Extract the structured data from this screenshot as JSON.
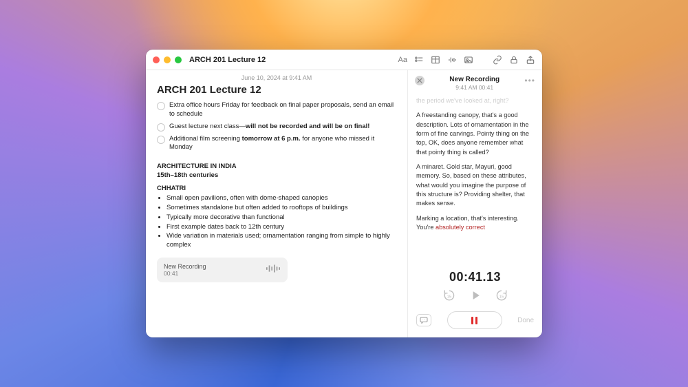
{
  "titlebar": {
    "title": "ARCH 201 Lecture 12"
  },
  "note": {
    "datestamp": "June 10, 2024 at 9:41 AM",
    "title": "ARCH 201 Lecture 12",
    "checklist": [
      {
        "pre": "Extra office hours Friday for feedback on final paper proposals, send an email to schedule",
        "bold": "",
        "post": ""
      },
      {
        "pre": "Guest lecture next class—",
        "bold": "will not be recorded and will be on final!",
        "post": ""
      },
      {
        "pre": "Additional film screening ",
        "bold": "tomorrow at 6 p.m.",
        "post": " for anyone who missed it Monday"
      }
    ],
    "heading1": "ARCHITECTURE IN INDIA",
    "heading2": "15th–18th centuries",
    "topic": "CHHATRI",
    "bullets": [
      "Small open pavilions, often with dome-shaped canopies",
      "Sometimes standalone but often added to rooftops of buildings",
      "Typically more decorative than functional",
      "First example dates back to 12th century",
      "Wide variation in materials used; ornamentation ranging from simple to highly complex"
    ],
    "chip": {
      "name": "New Recording",
      "time": "00:41"
    }
  },
  "panel": {
    "title": "New Recording",
    "subtitle": "9:41 AM  00:41",
    "faded": "the period we've looked at, right?",
    "p1": "A freestanding canopy, that's a good description. Lots of ornamentation in the form of fine carvings. Pointy thing on the top, OK, does anyone remember what that pointy thing is called?",
    "p2": "A minaret. Gold star, Mayuri, good memory. So, based on these attributes, what would you imagine the purpose of this structure is? Providing shelter, that makes sense.",
    "p3a": "Marking a location, that's interesting. You're ",
    "p3b_hi": "absolutely correct",
    "timer": "00:41.13",
    "done": "Done"
  }
}
